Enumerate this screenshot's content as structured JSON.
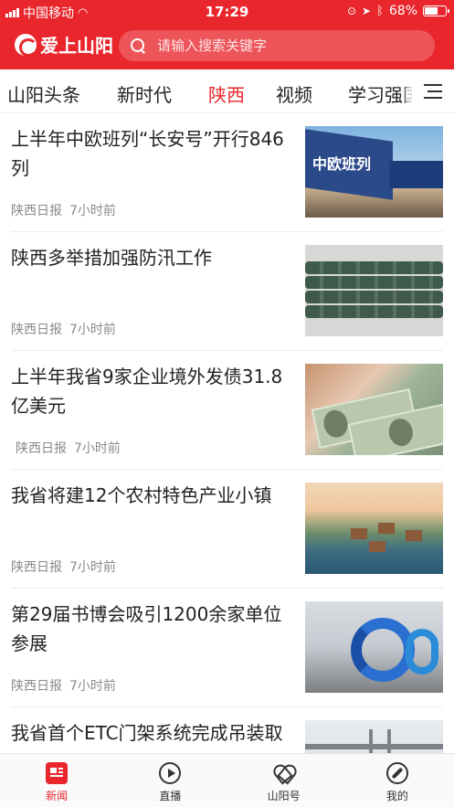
{
  "status_bar": {
    "carrier": "中国移动",
    "time": "17:29",
    "battery": "68%",
    "battery_level": 0.68
  },
  "header": {
    "logo_text": "爱上山阳",
    "search_placeholder": "请输入搜索关键字"
  },
  "channels": [
    {
      "label": "山阳头条"
    },
    {
      "label": "新时代"
    },
    {
      "label": "陕西",
      "active": true
    },
    {
      "label": "视频"
    },
    {
      "label": "学习强国"
    }
  ],
  "articles": [
    {
      "title": "上半年中欧班列“长安号”开行846列",
      "source": "陕西日报",
      "time": "7小时前",
      "thumb": "train-image"
    },
    {
      "title": "陕西多举措加强防汛工作",
      "source": "陕西日报",
      "time": "7小时前",
      "thumb": "sandbags-image"
    },
    {
      "title": "上半年我省9家企业境外发债31.8亿美元",
      "source": "陕西日报",
      "time": "7小时前",
      "thumb": "money-image"
    },
    {
      "title": "我省将建12个农村特色产业小镇",
      "source": "陕西日报",
      "time": "7小时前",
      "thumb": "town-image"
    },
    {
      "title": "第29届书博会吸引1200余家单位参展",
      "source": "陕西日报",
      "time": "7小时前",
      "thumb": "expo-image"
    },
    {
      "title": "我省首个ETC门架系统完成吊装取消高速公路省界收费站工程已",
      "source": "",
      "time": "",
      "thumb": "etc-gantry-image"
    }
  ],
  "tabbar": [
    {
      "label": "新闻",
      "icon": "news-icon",
      "active": true
    },
    {
      "label": "直播",
      "icon": "live-icon"
    },
    {
      "label": "山阳号",
      "icon": "shanyang-icon"
    },
    {
      "label": "我的",
      "icon": "compass-icon"
    }
  ],
  "colors": {
    "accent": "#e8262c",
    "meta": "#8a8a8a"
  }
}
